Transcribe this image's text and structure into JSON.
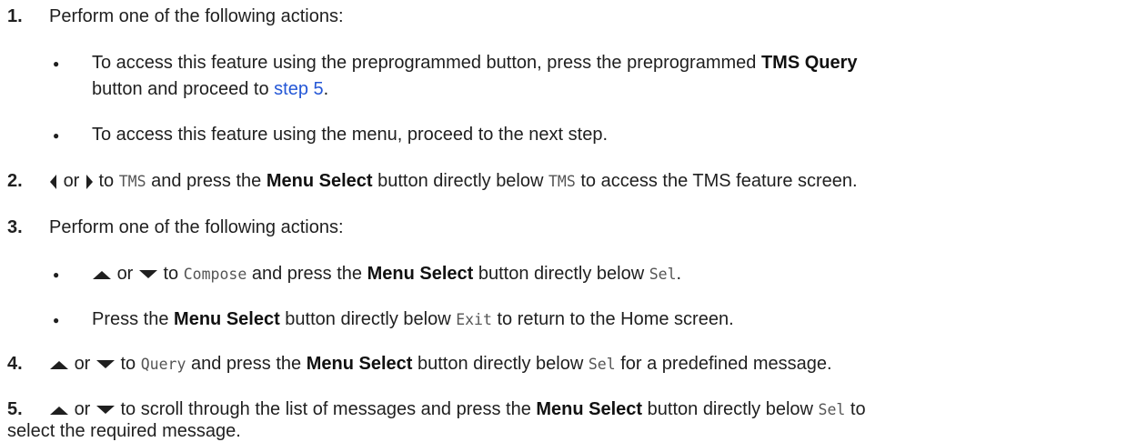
{
  "steps": [
    {
      "number": "1.",
      "text": "Perform one of the following actions:",
      "bullets": [
        {
          "lines": [
            {
              "t1": "To access this feature using the preprogrammed button, press the preprogrammed ",
              "b1": "TMS Query"
            },
            {
              "t1": "button and proceed to ",
              "link": "step 5",
              "t2": "."
            }
          ]
        },
        {
          "text": "To access this feature using the menu, proceed to the next step."
        }
      ]
    },
    {
      "number": "2.",
      "or": "or",
      "t1": "to ",
      "m1": "TMS",
      "t2": " and press the ",
      "b1": "Menu Select",
      "t3": " button directly below ",
      "m2": "TMS",
      "t4": " to access the TMS feature screen."
    },
    {
      "number": "3.",
      "text": "Perform one of the following actions:",
      "bullets": [
        {
          "or": "or",
          "t1": "to ",
          "m1": "Compose",
          "t2": " and press the ",
          "b1": "Menu Select",
          "t3": " button directly below ",
          "m2": "Sel",
          "t4": "."
        },
        {
          "t1": "Press the ",
          "b1": "Menu Select",
          "t2": " button directly below ",
          "m1": "Exit",
          "t3": " to return to the Home screen."
        }
      ]
    },
    {
      "number": "4.",
      "or": "or",
      "t1": "to ",
      "m1": "Query",
      "t2": " and press the ",
      "b1": "Menu Select",
      "t3": " button directly below ",
      "m2": "Sel",
      "t4": " for a predefined message."
    },
    {
      "number": "5.",
      "or": "or",
      "t1": "to scroll through the list of messages and press the ",
      "b1": "Menu Select",
      "t2": " button directly below ",
      "m1": "Sel",
      "t3": " to",
      "line2": "select the required message."
    }
  ],
  "icons": {
    "bullet": "●",
    "left": "left-arrow-icon",
    "right": "right-arrow-icon",
    "up": "up-arrow-icon",
    "down": "down-arrow-icon"
  }
}
